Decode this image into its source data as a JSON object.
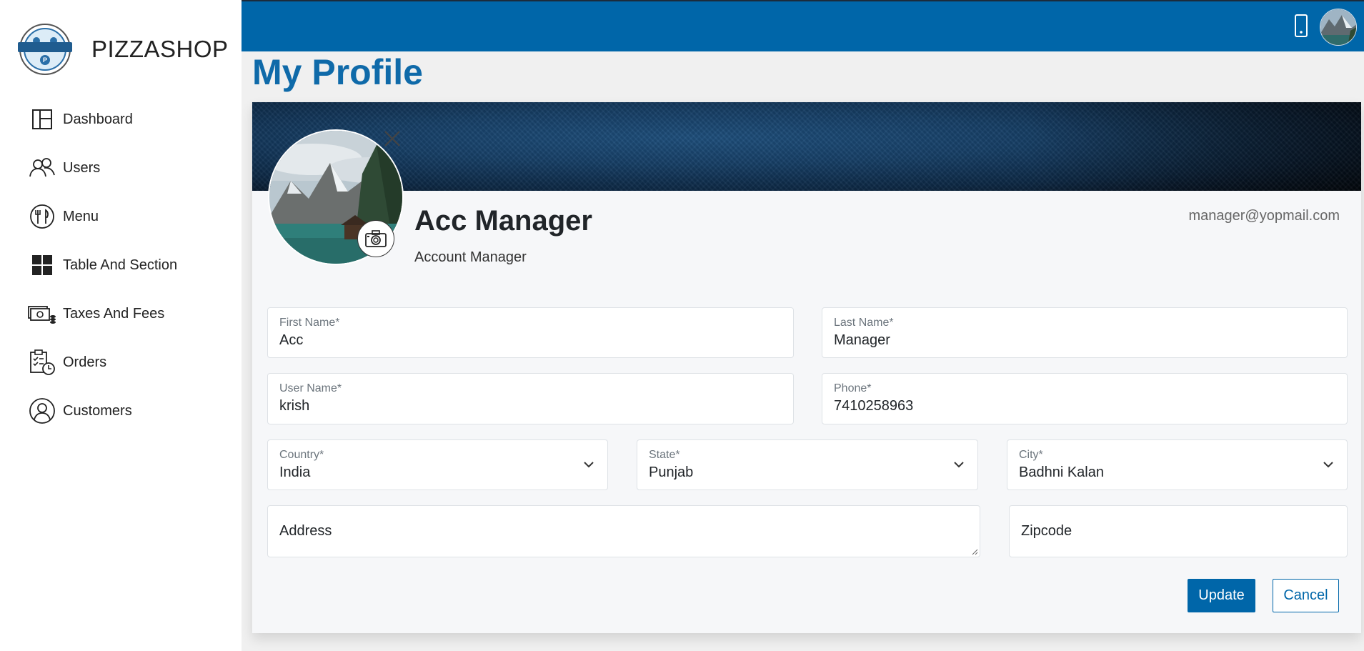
{
  "brand": {
    "name": "PIZZASHOP",
    "logo_text": "PIZZASHOP"
  },
  "sidebar": {
    "items": [
      {
        "label": "Dashboard",
        "icon": "dashboard-icon"
      },
      {
        "label": "Users",
        "icon": "users-icon"
      },
      {
        "label": "Menu",
        "icon": "menu-icon"
      },
      {
        "label": "Table And Section",
        "icon": "grid-icon"
      },
      {
        "label": "Taxes And Fees",
        "icon": "money-icon"
      },
      {
        "label": "Orders",
        "icon": "clipboard-clock-icon"
      },
      {
        "label": "Customers",
        "icon": "customer-icon"
      }
    ]
  },
  "topbar": {
    "icons": [
      "phone-icon",
      "avatar"
    ]
  },
  "page": {
    "title": "My Profile"
  },
  "profile": {
    "name": "Acc Manager",
    "role": "Account Manager",
    "email": "manager@yopmail.com"
  },
  "form": {
    "first_name": {
      "label": "First Name*",
      "value": "Acc"
    },
    "last_name": {
      "label": "Last Name*",
      "value": "Manager"
    },
    "user_name": {
      "label": "User Name*",
      "value": "krish"
    },
    "phone": {
      "label": "Phone*",
      "value": "7410258963"
    },
    "country": {
      "label": "Country*",
      "value": "India"
    },
    "state": {
      "label": "State*",
      "value": "Punjab"
    },
    "city": {
      "label": "City*",
      "value": "Badhni Kalan"
    },
    "address": {
      "placeholder": "Address"
    },
    "zipcode": {
      "placeholder": "Zipcode"
    }
  },
  "actions": {
    "update_label": "Update",
    "cancel_label": "Cancel"
  },
  "colors": {
    "primary": "#0066a9",
    "title": "#0f6aa9",
    "sidebar_bg": "#ffffff",
    "page_bg": "#f0f0f0"
  }
}
